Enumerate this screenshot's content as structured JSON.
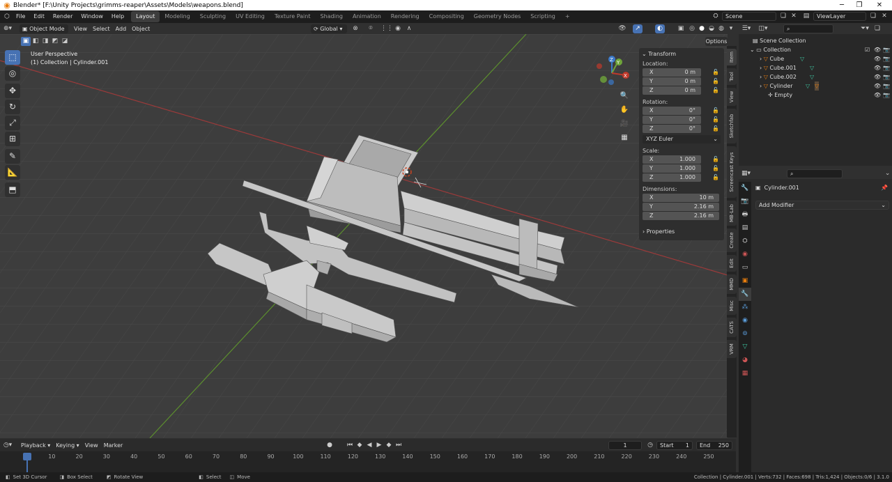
{
  "title": "Blender* [F:\\Unity Projects\\grimms-reaper\\Assets\\Models\\weapons.blend]",
  "menu": [
    "File",
    "Edit",
    "Render",
    "Window",
    "Help"
  ],
  "workspaces": [
    "Layout",
    "Modeling",
    "Sculpting",
    "UV Editing",
    "Texture Paint",
    "Shading",
    "Animation",
    "Rendering",
    "Compositing",
    "Geometry Nodes",
    "Scripting"
  ],
  "active_workspace": "Layout",
  "add_workspace": "+",
  "scene": "Scene",
  "view_layer": "ViewLayer",
  "viewport_header": {
    "mode": "Object Mode",
    "menus": [
      "View",
      "Select",
      "Add",
      "Object"
    ],
    "orientation": "Global",
    "options": "Options"
  },
  "viewport_info": {
    "perspective": "User Perspective",
    "collection": "(1) Collection | Cylinder.001"
  },
  "gizmo": {
    "x": "X",
    "y": "Y",
    "z": "Z"
  },
  "transform": {
    "header": "Transform",
    "location_label": "Location:",
    "location": [
      {
        "axis": "X",
        "value": "0 m"
      },
      {
        "axis": "Y",
        "value": "0 m"
      },
      {
        "axis": "Z",
        "value": "0 m"
      }
    ],
    "rotation_label": "Rotation:",
    "rotation": [
      {
        "axis": "X",
        "value": "0°"
      },
      {
        "axis": "Y",
        "value": "0°"
      },
      {
        "axis": "Z",
        "value": "0°"
      }
    ],
    "rotation_mode": "XYZ Euler",
    "scale_label": "Scale:",
    "scale": [
      {
        "axis": "X",
        "value": "1.000"
      },
      {
        "axis": "Y",
        "value": "1.000"
      },
      {
        "axis": "Z",
        "value": "1.000"
      }
    ],
    "dimensions_label": "Dimensions:",
    "dimensions": [
      {
        "axis": "X",
        "value": "10 m"
      },
      {
        "axis": "Y",
        "value": "2.16 m"
      },
      {
        "axis": "Z",
        "value": "2.16 m"
      }
    ],
    "properties": "Properties"
  },
  "side_tabs": [
    "Item",
    "Tool",
    "View",
    "Sketchfab",
    "Screencast Keys",
    "MB-Lab",
    "Create",
    "Edit",
    "MMD",
    "Misc",
    "CATS",
    "VRM"
  ],
  "outliner": {
    "root": "Scene Collection",
    "collection": "Collection",
    "items": [
      "Cube",
      "Cube.001",
      "Cube.002",
      "Cylinder",
      "Empty"
    ]
  },
  "properties_panel": {
    "object": "Cylinder.001",
    "add_modifier": "Add Modifier"
  },
  "timeline": {
    "menus": [
      "Playback",
      "Keying",
      "View",
      "Marker"
    ],
    "current_frame": "1",
    "start_label": "Start",
    "start": "1",
    "end_label": "End",
    "end": "250",
    "ticks": [
      "1",
      "10",
      "20",
      "30",
      "40",
      "50",
      "60",
      "70",
      "80",
      "90",
      "100",
      "110",
      "120",
      "130",
      "140",
      "150",
      "160",
      "170",
      "180",
      "190",
      "200",
      "210",
      "220",
      "230",
      "240",
      "250"
    ]
  },
  "status": {
    "left": [
      "Set 3D Cursor",
      "Box Select",
      "Rotate View",
      "Select",
      "Move"
    ],
    "right": "Collection | Cylinder.001 | Verts:732 | Faces:698 | Tris:1,424 | Objects:0/6 | 3.1.0"
  },
  "colors": {
    "accent": "#4772b3",
    "x_axis": "#c0392b",
    "y_axis": "#6fa53a",
    "z_axis": "#3b79c9"
  }
}
